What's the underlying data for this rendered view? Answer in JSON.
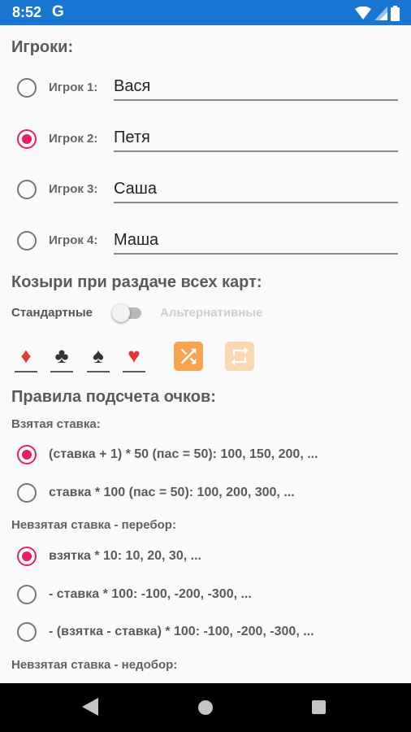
{
  "status_bar": {
    "time": "8:52",
    "g_label": "G"
  },
  "players": {
    "title": "Игроки:",
    "items": [
      {
        "label": "Игрок 1:",
        "name": "Вася",
        "selected": false
      },
      {
        "label": "Игрок 2:",
        "name": "Петя",
        "selected": true
      },
      {
        "label": "Игрок 3:",
        "name": "Саша",
        "selected": false
      },
      {
        "label": "Игрок 4:",
        "name": "Маша",
        "selected": false
      }
    ]
  },
  "trumps": {
    "title": "Козыри при раздаче всех карт:",
    "standard_label": "Стандартные",
    "alternative_label": "Альтернативные",
    "switch_on": false,
    "suits": [
      {
        "icon": "diamond-icon",
        "glyph": "♦",
        "color": "#e53935"
      },
      {
        "icon": "club-icon",
        "glyph": "♣",
        "color": "#333333"
      },
      {
        "icon": "spade-icon",
        "glyph": "♠",
        "color": "#333333"
      },
      {
        "icon": "heart-icon",
        "glyph": "♥",
        "color": "#e53935"
      }
    ],
    "shuffle_icon": "shuffle-icon",
    "repeat_icon": "repeat-icon"
  },
  "scoring": {
    "title": "Правила подсчета очков:",
    "taken_bid": {
      "title": "Взятая ставка:",
      "options": [
        {
          "text": "(ставка + 1) * 50 (пас = 50): 100, 150, 200, ...",
          "selected": true
        },
        {
          "text": "ставка * 100 (пас = 50): 100, 200, 300, ...",
          "selected": false
        }
      ]
    },
    "overtrick": {
      "title": "Невзятая ставка - перебор:",
      "options": [
        {
          "text": "взятка * 10: 10, 20, 30, ...",
          "selected": true
        },
        {
          "text": "- ставка * 100: -100, -200, -300, ...",
          "selected": false
        },
        {
          "text": "- (взятка - ставка) * 100: -100, -200, -300, ...",
          "selected": false
        }
      ]
    },
    "undertrick": {
      "title": "Невзятая ставка - недобор:"
    }
  },
  "colors": {
    "accent": "#e91e63",
    "status_bar": "#1976d2",
    "shuffle": "#f7a450",
    "repeat": "#fbd8b2"
  }
}
